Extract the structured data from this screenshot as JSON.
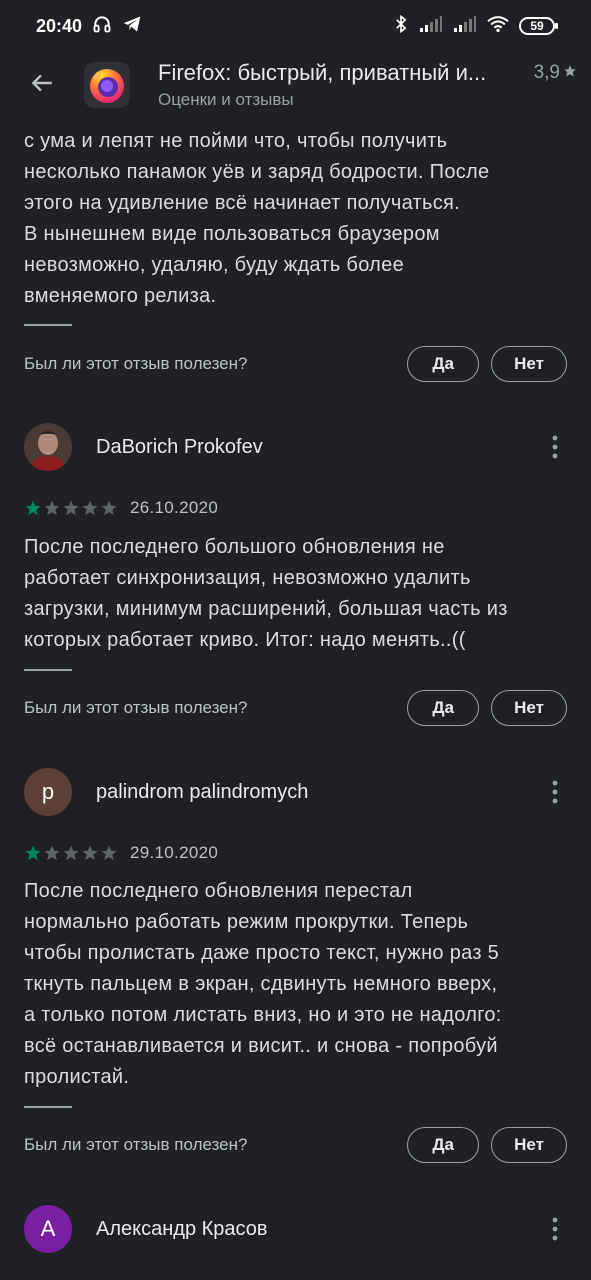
{
  "status_bar": {
    "time": "20:40",
    "battery": "59"
  },
  "header": {
    "title": "Firefox: быстрый, приватный и...",
    "subtitle": "Оценки и отзывы",
    "rating": "3,9"
  },
  "helpful": {
    "question": "Был ли этот отзыв полезен?",
    "yes": "Да",
    "no": "Нет"
  },
  "reviews": [
    {
      "text_lines": [
        "с ума и лепят не пойми что, чтобы получить",
        "несколько панамок уёв и заряд бодрости. После",
        "этого на удивление всё начинает получаться.",
        "В нынешнем виде пользоваться браузером",
        "невозможно, удаляю, буду ждать более",
        "вменяемого релиза."
      ]
    },
    {
      "author": "DaBorich Prokofev",
      "date": "26.10.2020",
      "stars": 1,
      "text_lines": [
        "После последнего большого обновления не",
        "работает синхронизация, невозможно удалить",
        "загрузки, минимум расширений, большая часть из",
        "которых работает криво. Итог: надо менять..(("
      ]
    },
    {
      "author": "palindrom palindromych",
      "avatar_letter": "p",
      "date": "29.10.2020",
      "stars": 1,
      "text_lines": [
        "После последнего обновления перестал",
        "нормально работать режим прокрутки. Теперь",
        "чтобы пролистать даже просто текст, нужно раз 5",
        "ткнуть пальцем в экран, сдвинуть немного вверх,",
        "а только потом листать вниз, но и это не надолго:",
        "всё останавливается и висит.. и снова - попробуй",
        "пролистай."
      ]
    },
    {
      "author": "Александр Красов",
      "avatar_letter": "A"
    }
  ],
  "colors": {
    "background": "#202124",
    "star_filled": "#01875f",
    "star_empty": "#5f6368",
    "avatar_p": "#5d4037",
    "avatar_a": "#7b1fa2"
  },
  "icons": [
    "back-arrow-icon",
    "firefox-logo-icon",
    "star-icon",
    "more-vert-icon",
    "headphones-icon",
    "telegram-icon",
    "bluetooth-icon",
    "signal-icon",
    "wifi-icon",
    "battery-icon"
  ]
}
